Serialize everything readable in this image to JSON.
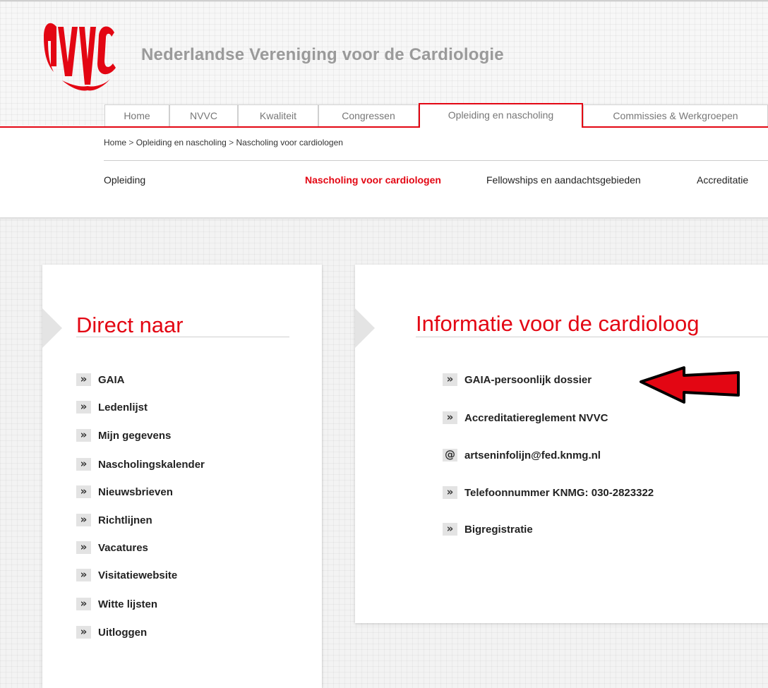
{
  "site": {
    "title": "Nederlandse Vereniging voor de Cardiologie",
    "logo_text": "NVVC"
  },
  "tabs": [
    {
      "label": "Home"
    },
    {
      "label": "NVVC"
    },
    {
      "label": "Kwaliteit"
    },
    {
      "label": "Congressen"
    },
    {
      "label": "Opleiding en nascholing",
      "active": true
    },
    {
      "label": "Commissies & Werkgroepen"
    }
  ],
  "breadcrumb": {
    "items": [
      "Home",
      "Opleiding en nascholing",
      "Nascholing voor cardiologen"
    ],
    "separator": ">"
  },
  "subnav": [
    {
      "label": "Opleiding"
    },
    {
      "label": "Nascholing voor cardiologen",
      "active": true
    },
    {
      "label": "Fellowships en aandachtsgebieden"
    },
    {
      "label": "Accreditatie"
    }
  ],
  "direct_naar": {
    "title": "Direct naar",
    "items": [
      {
        "label": "GAIA"
      },
      {
        "label": "Ledenlijst"
      },
      {
        "label": "Mijn gegevens"
      },
      {
        "label": "Nascholingskalender"
      },
      {
        "label": "Nieuwsbrieven"
      },
      {
        "label": "Richtlijnen"
      },
      {
        "label": "Vacatures"
      },
      {
        "label": "Visitatiewebsite"
      },
      {
        "label": "Witte lijsten"
      },
      {
        "label": "Uitloggen"
      }
    ]
  },
  "informatie": {
    "title": "Informatie voor de cardioloog",
    "items": [
      {
        "icon": "»",
        "label": "GAIA-persoonlijk dossier"
      },
      {
        "icon": "»",
        "label": "Accreditatiereglement NVVC"
      },
      {
        "icon": "@",
        "label": "artseninfolijn@fed.knmg.nl"
      },
      {
        "icon": "»",
        "label": "Telefoonnummer KNMG: 030-2823322"
      },
      {
        "icon": "»",
        "label": "Bigregistratie"
      }
    ]
  },
  "icons": {
    "chevron": "»",
    "at": "@"
  },
  "colors": {
    "brand_red": "#e30613",
    "title_gray": "#9a9a9a",
    "chevron_bg": "#e3e3e3"
  }
}
